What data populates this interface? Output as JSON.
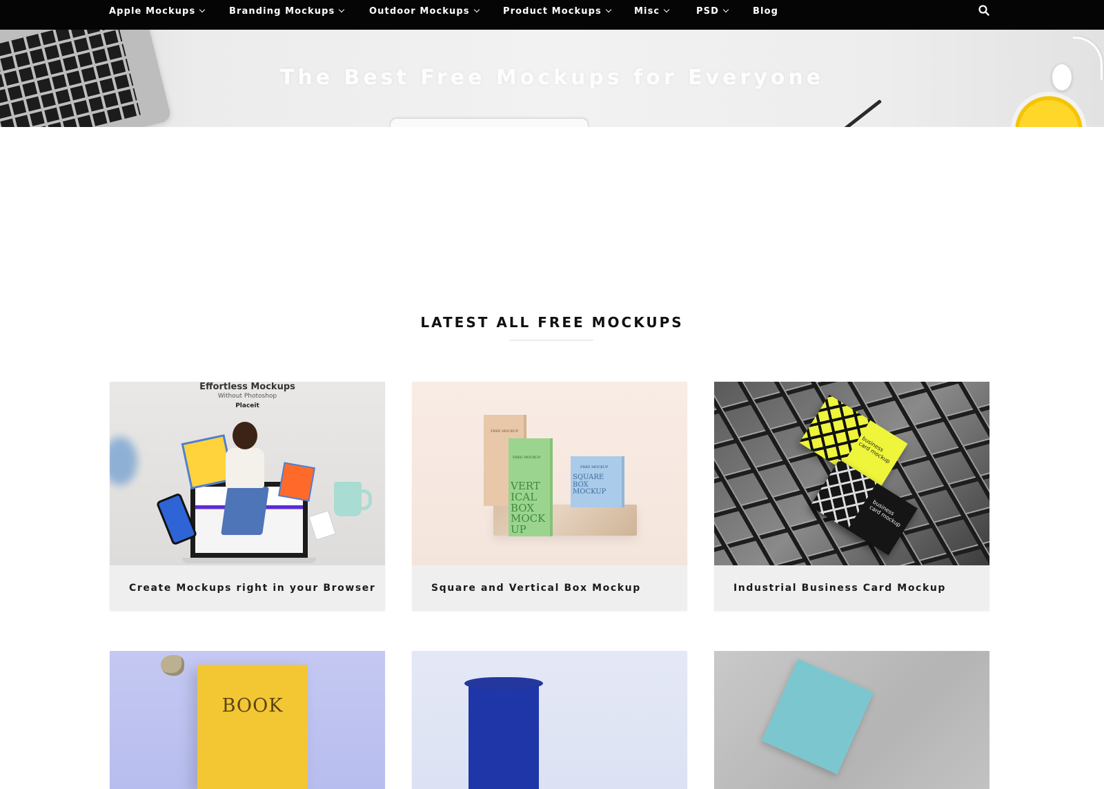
{
  "nav": {
    "items": [
      {
        "label": "Apple Mockups",
        "dropdown": true
      },
      {
        "label": "Branding Mockups",
        "dropdown": true
      },
      {
        "label": "Outdoor Mockups",
        "dropdown": true
      },
      {
        "label": "Product Mockups",
        "dropdown": true
      },
      {
        "label": "Misc",
        "dropdown": true
      },
      {
        "label": "PSD",
        "dropdown": true
      },
      {
        "label": "Blog",
        "dropdown": false
      }
    ],
    "search_icon": "search-icon"
  },
  "hero": {
    "title": "The Best Free Mockups for Everyone"
  },
  "section": {
    "heading": "LATEST ALL FREE MOCKUPS"
  },
  "cards": [
    {
      "title": "Create Mockups right in your Browser",
      "thumb_heading": "Effortless Mockups",
      "thumb_subheading": "Without Photoshop",
      "thumb_brand": "Placeit"
    },
    {
      "title": "Square and Vertical Box Mockup",
      "box_label_small": "FREE MOCKUP",
      "box_text_vertical": "VERT ICAL BOX MOCK UP",
      "box_text_square": "SQUARE BOX MOCKUP"
    },
    {
      "title": "Industrial Business Card Mockup",
      "card_text": "business card mockup"
    },
    {
      "title": "",
      "thumb_text": "BOOK"
    },
    {
      "title": ""
    },
    {
      "title": ""
    }
  ],
  "colors": {
    "nav_bg": "#050505",
    "card_bg": "#efefef",
    "heading_text": "#111111"
  }
}
